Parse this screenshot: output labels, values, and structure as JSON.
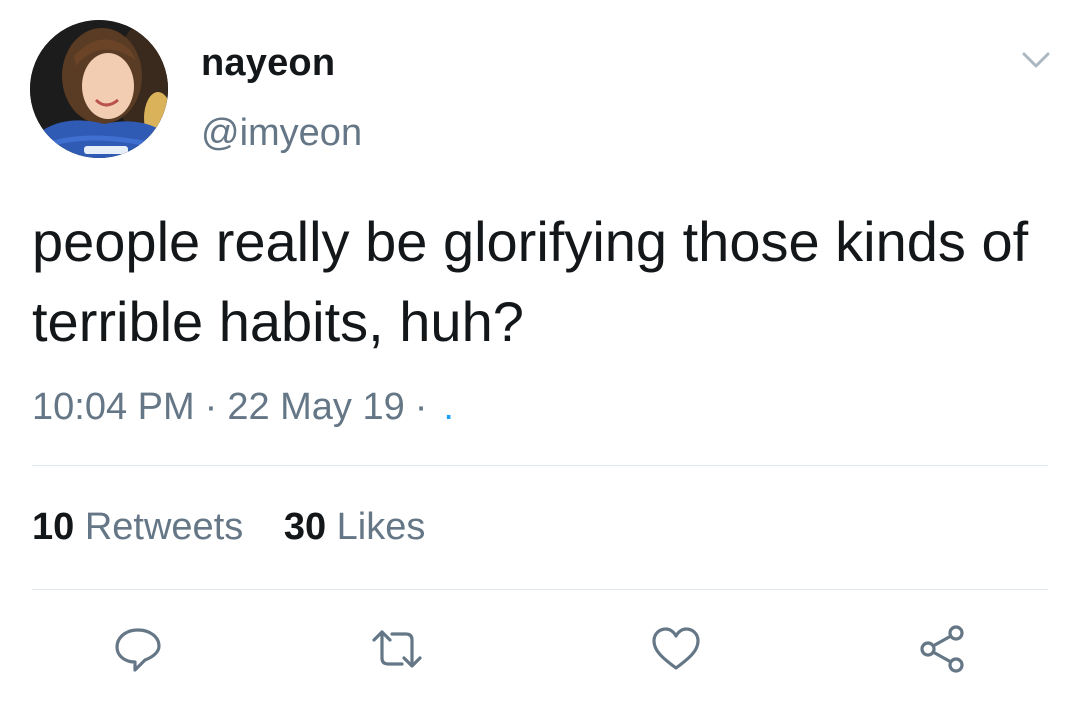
{
  "user": {
    "display_name": "nayeon",
    "handle": "@imyeon"
  },
  "tweet": {
    "text": "people really be glorifying those kinds of terrible habits, huh?",
    "time": "10:04 PM",
    "date": "22 May 19",
    "separator": "·",
    "source": "."
  },
  "stats": {
    "retweets_count": "10",
    "retweets_label": "Retweets",
    "likes_count": "30",
    "likes_label": "Likes"
  },
  "icons": {
    "caret": "chevron-down-icon",
    "reply": "reply-icon",
    "retweet": "retweet-icon",
    "like": "heart-icon",
    "share": "share-icon"
  },
  "colors": {
    "text": "#14171a",
    "secondary": "#657786",
    "link": "#1da1f2",
    "divider": "#e1e8ed"
  }
}
